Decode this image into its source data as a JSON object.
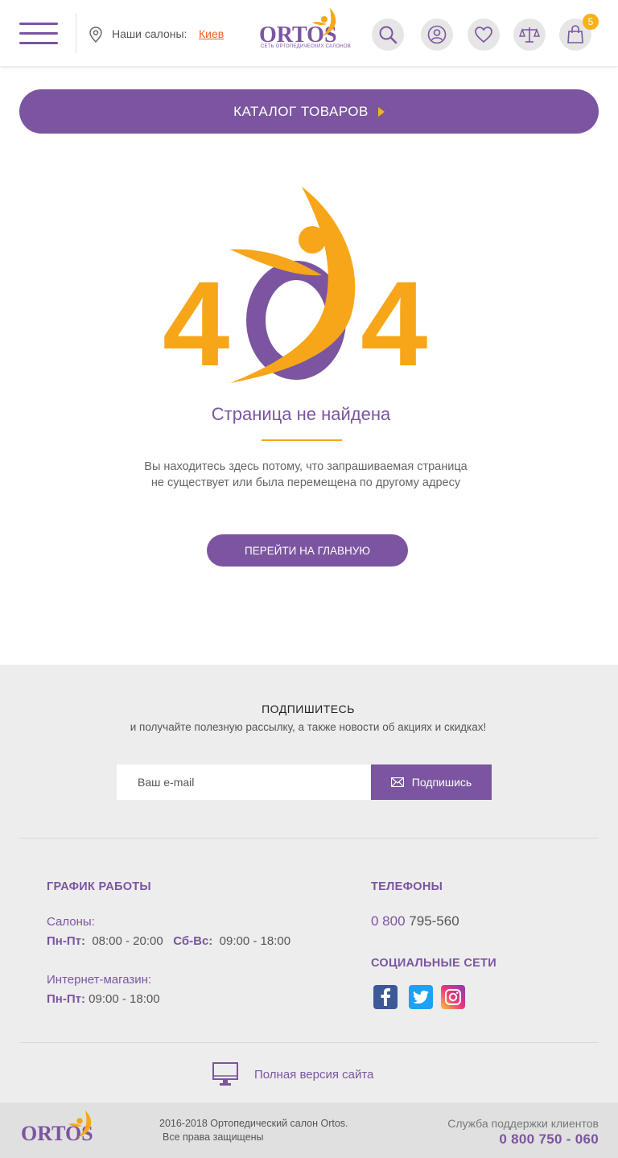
{
  "header": {
    "salons_label": "Наши салоны:",
    "city": "Киев",
    "logo_text": "ORTOS",
    "logo_subtitle": "СЕТЬ ОРТОПЕДИЧЕСКИХ САЛОНОВ",
    "cart_count": "5"
  },
  "catalog": {
    "label": "КАТАЛОГ ТОВАРОВ"
  },
  "not_found": {
    "code_left": "4",
    "code_right": "4",
    "title": "Страница не найдена",
    "desc_line1": "Вы находитесь здесь потому, что запрашиваемая страница",
    "desc_line2": "не существует или была перемещена по другому адресу",
    "home_button": "ПЕРЕЙТИ НА ГЛАВНУЮ"
  },
  "subscribe": {
    "title": "ПОДПИШИТЕСЬ",
    "desc": "и получайте полезную рассылку, а также новости об акциях и скидках!",
    "placeholder": "Ваш e-mail",
    "button": "Подпишись"
  },
  "schedule": {
    "heading": "ГРАФИК РАБОТЫ",
    "salons_label": "Салоны:",
    "weekdays_label": "Пн-Пт:",
    "weekdays_hours": "08:00 - 20:00",
    "weekend_label": "Сб-Вс:",
    "weekend_hours": "09:00 - 18:00",
    "shop_label": "Интернет-магазин:",
    "shop_days_label": "Пн-Пт:",
    "shop_hours": "09:00 - 18:00"
  },
  "contacts": {
    "phones_heading": "ТЕЛЕФОНЫ",
    "phone_prefix": "0 800",
    "phone_number": "795-560",
    "social_heading": "СОЦИАЛЬНЫЕ СЕТИ"
  },
  "full_version": {
    "label": "Полная версия сайта"
  },
  "bottom": {
    "logo_text": "ORTOS",
    "copyright_line1": "2016-2018  Ортопедический салон Ortos.",
    "copyright_line2": "Все права защищены",
    "support_label": "Служба поддержки клиентов",
    "support_phone": "0 800 750 - 060"
  },
  "colors": {
    "brand_purple": "#7b55a0",
    "accent_orange": "#f7a61a",
    "link_orange": "#e8622a"
  }
}
